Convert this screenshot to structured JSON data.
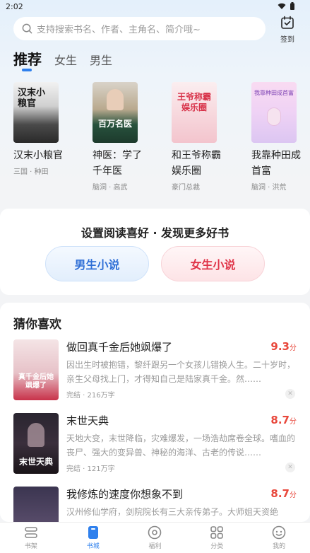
{
  "status_bar": {
    "time": "2:02"
  },
  "search": {
    "placeholder": "支持搜索书名、作者、主角名、简介哦~"
  },
  "checkin": {
    "label": "签到"
  },
  "tabs": [
    {
      "label": "推荐",
      "active": true
    },
    {
      "label": "女生",
      "active": false
    },
    {
      "label": "男生",
      "active": false
    }
  ],
  "books": [
    {
      "title": "汉末小粮官",
      "meta": "三国 · 种田",
      "cover_text": "汉末小粮官"
    },
    {
      "title": "神医：学了千年医",
      "meta": "脑洞 · 高武",
      "cover_text": "百万名医"
    },
    {
      "title": "和王爷称霸娱乐圈",
      "meta": "豪门总裁",
      "cover_text": "王爷称霸娱乐圈"
    },
    {
      "title": "我靠种田成首富",
      "meta": "脑洞 · 洪荒",
      "cover_text": "我靠种田成首富"
    }
  ],
  "preference": {
    "title": "设置阅读喜好 · 发现更多好书",
    "male_label": "男生小说",
    "female_label": "女生小说"
  },
  "guess": {
    "title": "猜你喜欢",
    "items": [
      {
        "title": "做回真千金后她飒爆了",
        "score": "9.3",
        "score_unit": "分",
        "desc": "因出生时被抱错，黎纤跟另一个女孩儿错换人生。二十岁时，亲生父母找上门，才得知自己是陆家真千金。然……",
        "meta": "完结 · 216万字",
        "cover_text": "真千金后她飒爆了"
      },
      {
        "title": "末世天典",
        "score": "8.7",
        "score_unit": "分",
        "desc": "天地大变，末世降临，灾难爆发，一场浩劫席卷全球。嗜血的丧尸、强大的变异兽、神秘的海洋、古老的传说……",
        "meta": "完结 · 121万字",
        "cover_text": "末世天典"
      },
      {
        "title": "我修炼的速度你想象不到",
        "score": "8.7",
        "score_unit": "分",
        "desc": "汉州修仙学府，剑院院长有三大亲传弟子。大师姐天资绝",
        "meta": "",
        "cover_text": ""
      }
    ]
  },
  "bottom_nav": [
    {
      "label": "书架",
      "icon": "bookshelf-icon",
      "active": false
    },
    {
      "label": "书城",
      "icon": "bookstore-icon",
      "active": true
    },
    {
      "label": "福利",
      "icon": "welfare-icon",
      "active": false
    },
    {
      "label": "分类",
      "icon": "category-icon",
      "active": false
    },
    {
      "label": "我的",
      "icon": "profile-icon",
      "active": false
    }
  ],
  "colors": {
    "accent": "#2f80ed",
    "score": "#e8473b",
    "female": "#e03448",
    "male": "#2f6fd6"
  }
}
